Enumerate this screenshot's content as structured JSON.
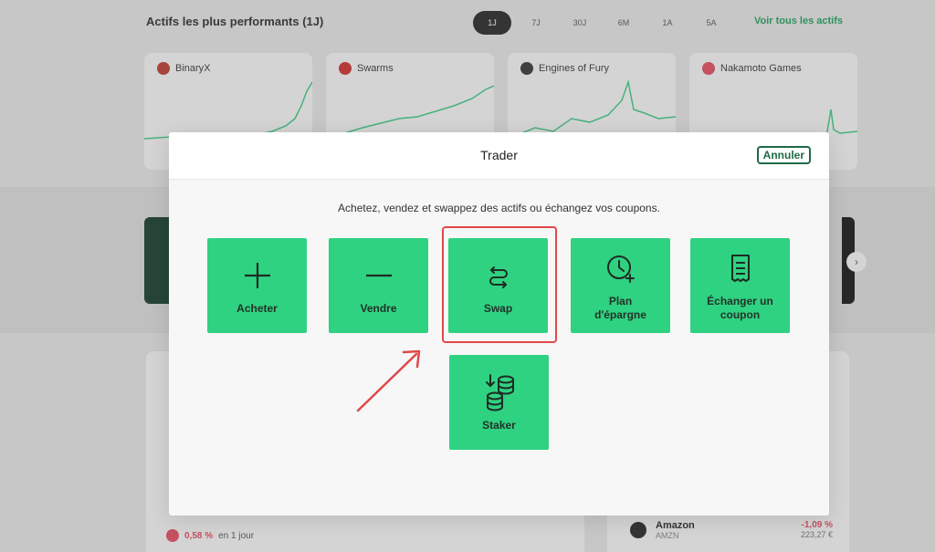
{
  "background": {
    "section_title": "Actifs les plus performants (1J)",
    "periods": [
      "1J",
      "7J",
      "30J",
      "6M",
      "1A",
      "5A"
    ],
    "active_period": "1J",
    "view_all": "Voir tous les actifs",
    "cards": [
      {
        "name": "BinaryX",
        "icon_color": "#c0392b"
      },
      {
        "name": "Swarms",
        "icon_color": "#d62d2d"
      },
      {
        "name": "Engines of Fury",
        "icon_color": "#333333"
      },
      {
        "name": "Nakamoto Games",
        "icon_color": "#e84a5f"
      }
    ],
    "bottom_change": {
      "value": "0,58 %",
      "period": "en 1 jour"
    },
    "amazon": {
      "name": "Amazon",
      "ticker": "AMZN",
      "change": "-1,09 %",
      "price": "223,27 €"
    }
  },
  "modal": {
    "title": "Trader",
    "cancel_label": "Annuler",
    "description": "Achetez, vendez et swappez des actifs ou échangez vos coupons.",
    "actions": [
      {
        "id": "acheter",
        "label": "Acheter",
        "icon": "plus-icon"
      },
      {
        "id": "vendre",
        "label": "Vendre",
        "icon": "minus-icon"
      },
      {
        "id": "swap",
        "label": "Swap",
        "icon": "swap-arrows-icon"
      },
      {
        "id": "plan",
        "label": "Plan d'épargne",
        "icon": "clock-plus-icon"
      },
      {
        "id": "coupon",
        "label": "Échanger un coupon",
        "icon": "receipt-icon"
      },
      {
        "id": "staker",
        "label": "Staker",
        "icon": "coin-stack-icon"
      }
    ]
  },
  "colors": {
    "action_green": "#2fd281",
    "brand_dark_green": "#1e6b45",
    "annotation_red": "#e04848"
  },
  "annotation": {
    "highlighted_action": "Swap"
  }
}
